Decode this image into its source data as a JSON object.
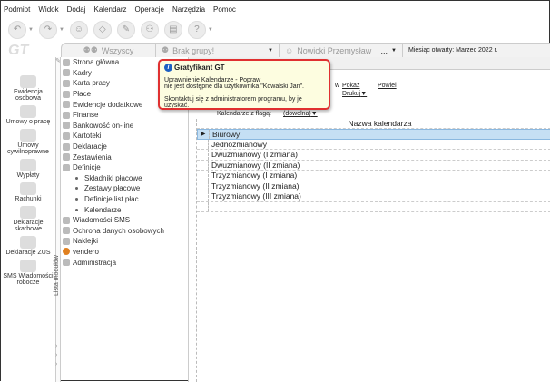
{
  "menu": [
    "Podmiot",
    "Widok",
    "Dodaj",
    "Kalendarz",
    "Operacje",
    "Narzędzia",
    "Pomoc"
  ],
  "logo": "GT",
  "tabs": {
    "all": "Wszyscy",
    "group": "Brak grupy!",
    "user": "Nowicki Przemysław",
    "user_more": "...",
    "month": "Miesiąc otwarty: Marzec 2022 r."
  },
  "left_buttons": [
    "Ewidencja osobowa",
    "Umowy o pracę",
    "Umowy cywilnoprawne",
    "Wypłaty",
    "Rachunki",
    "Deklaracje skarbowe",
    "Deklaracje ZUS",
    "SMS Wiadomości robocze"
  ],
  "modules_label": "Lista modułów",
  "modules": [
    "Strona główna",
    "Kadry",
    "Karta pracy",
    "Płace",
    "Ewidencje dodatkowe",
    "Finanse",
    "Bankowość on-line",
    "Kartoteki",
    "Deklaracje",
    "Zestawienia",
    "Definicje"
  ],
  "definicje_sub": [
    "Składniki płacowe",
    "Zestawy płacowe",
    "Definicje list płac",
    "Kalendarze"
  ],
  "modules2": [
    "Wiadomości SMS",
    "Ochrona danych osobowych",
    "Naklejki",
    "vendero",
    "Administracja"
  ],
  "actions": {
    "show": "Pokaż",
    "copy": "Powiel",
    "print": "Drukuj",
    "partial": "w"
  },
  "filter": {
    "label": "Kalendarze z flagą:",
    "value": "(dowolna)"
  },
  "grid": {
    "header": "Nazwa kalendarza",
    "rows": [
      "Biurowy",
      "Jednozmianowy",
      "Dwuzmianowy (I zmiana)",
      "Dwuzmianowy (II zmiana)",
      "Trzyzmianowy (I zmiana)",
      "Trzyzmianowy (II zmiana)",
      "Trzyzmianowy (III zmiana)"
    ]
  },
  "tooltip": {
    "title": "Gratyfikant GT",
    "line1": "Uprawnienie Kalendarze - Popraw",
    "line2": "nie jest dostępne dla użytkownika \"Kowalski Jan\".",
    "line3": "Skontaktuj się z administratorem programu, by je uzyskać."
  }
}
